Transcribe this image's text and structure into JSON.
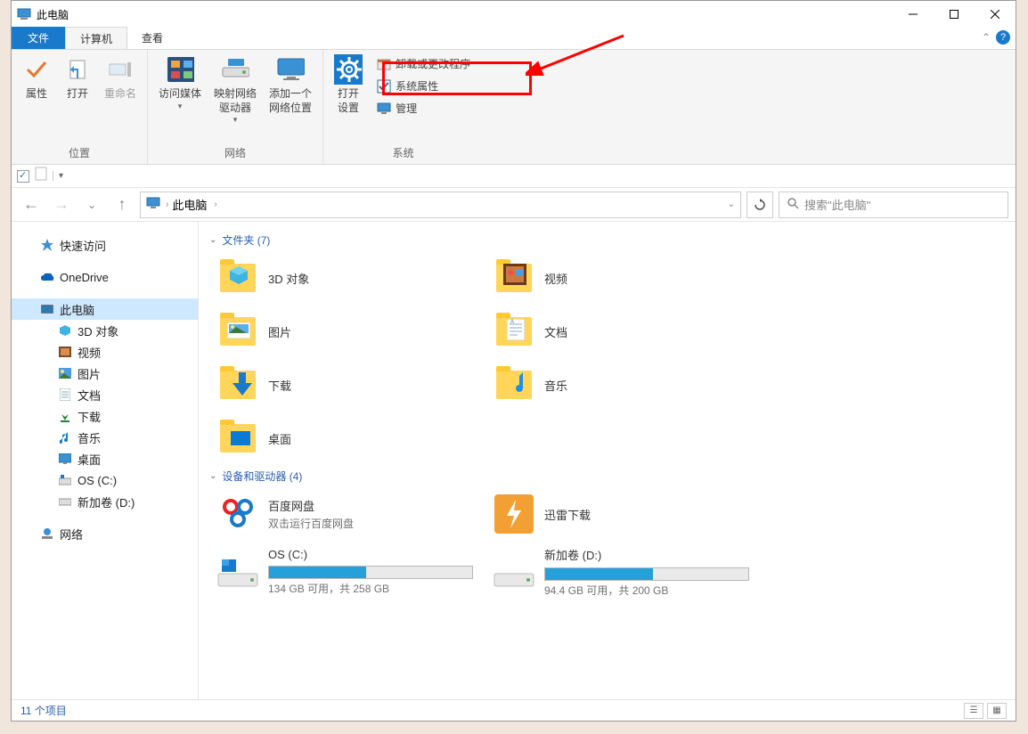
{
  "window": {
    "title": "此电脑"
  },
  "tabs": {
    "file": "文件",
    "computer": "计算机",
    "view": "查看"
  },
  "ribbon": {
    "location": {
      "label": "位置",
      "properties": "属性",
      "open": "打开",
      "rename": "重命名"
    },
    "network": {
      "label": "网络",
      "media": "访问媒体",
      "mapdrive": "映射网络\n驱动器",
      "addloc": "添加一个\n网络位置"
    },
    "system": {
      "label": "系统",
      "opensettings": "打开\n设置",
      "uninstall": "卸载或更改程序",
      "props": "系统属性",
      "manage": "管理"
    }
  },
  "breadcrumb": {
    "root": "此电脑"
  },
  "search": {
    "placeholder": "搜索\"此电脑\""
  },
  "nav": {
    "quick": "快速访问",
    "onedrive": "OneDrive",
    "thispc": "此电脑",
    "d3": "3D 对象",
    "videos": "视频",
    "pictures": "图片",
    "documents": "文档",
    "downloads": "下载",
    "music": "音乐",
    "desktop": "桌面",
    "osc": "OS (C:)",
    "dnew": "新加卷 (D:)",
    "network": "网络"
  },
  "groups": {
    "folders": "文件夹 (7)",
    "devices": "设备和驱动器 (4)"
  },
  "folders": {
    "d3": "3D 对象",
    "videos": "视频",
    "pictures": "图片",
    "documents": "文档",
    "downloads": "下载",
    "music": "音乐",
    "desktop": "桌面"
  },
  "devices": {
    "baidu": {
      "name": "百度网盘",
      "sub": "双击运行百度网盘"
    },
    "xunlei": {
      "name": "迅雷下载"
    },
    "c": {
      "name": "OS (C:)",
      "info": "134 GB 可用，共 258 GB",
      "fill": 48
    },
    "d": {
      "name": "新加卷 (D:)",
      "info": "94.4 GB 可用，共 200 GB",
      "fill": 53
    }
  },
  "status": {
    "count": "11 个项目"
  }
}
